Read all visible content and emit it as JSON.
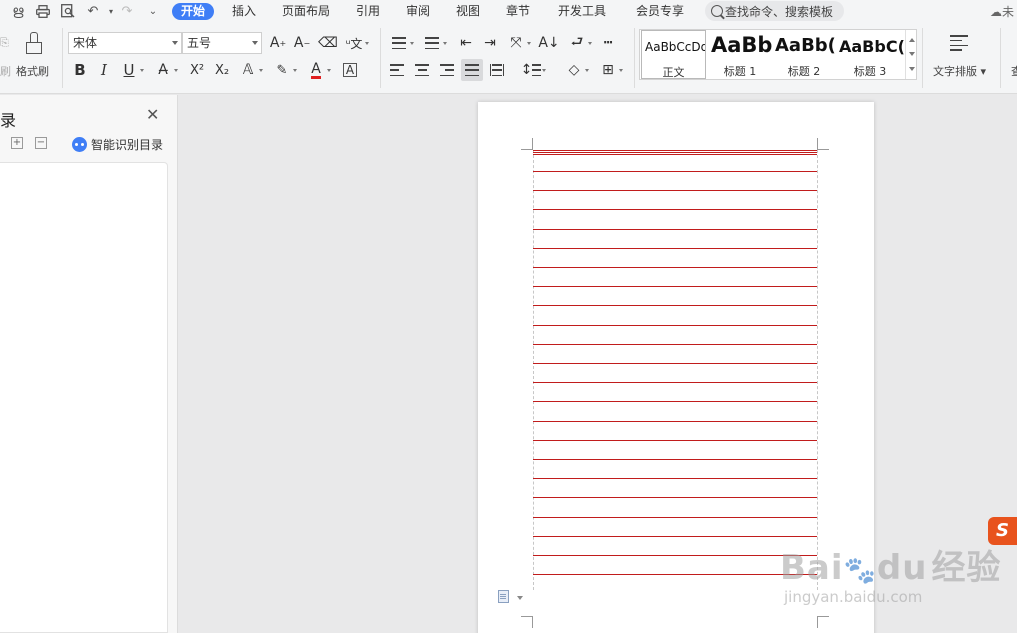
{
  "menubar": {
    "tabs": [
      "开始",
      "插入",
      "页面布局",
      "引用",
      "审阅",
      "视图",
      "章节",
      "开发工具",
      "会员专享"
    ],
    "search_placeholder": "查找命令、搜索模板",
    "cloud_label": "未"
  },
  "ribbon": {
    "format_painter": "格式刷",
    "font_name": "宋体",
    "font_size": "五号",
    "styles": [
      {
        "sample": "AaBbCcDd",
        "name": "正文"
      },
      {
        "sample": "AaBb",
        "name": "标题 1"
      },
      {
        "sample": "AaBb(",
        "name": "标题 2"
      },
      {
        "sample": "AaBbC(",
        "name": "标题 3"
      }
    ],
    "text_layout": "文字排版",
    "text_layout_cut": "查"
  },
  "navpane": {
    "title": "录",
    "smart_toc": "智能识别目录"
  },
  "colors": {
    "accent": "#3f7ef6",
    "ruled_line": "#c11c1c",
    "ime": "#e8531d"
  },
  "watermark": {
    "brand": "Bai",
    "brand2": "du",
    "brand3": "经验",
    "url": "jingyan.baidu.com"
  },
  "ime_label": "S"
}
